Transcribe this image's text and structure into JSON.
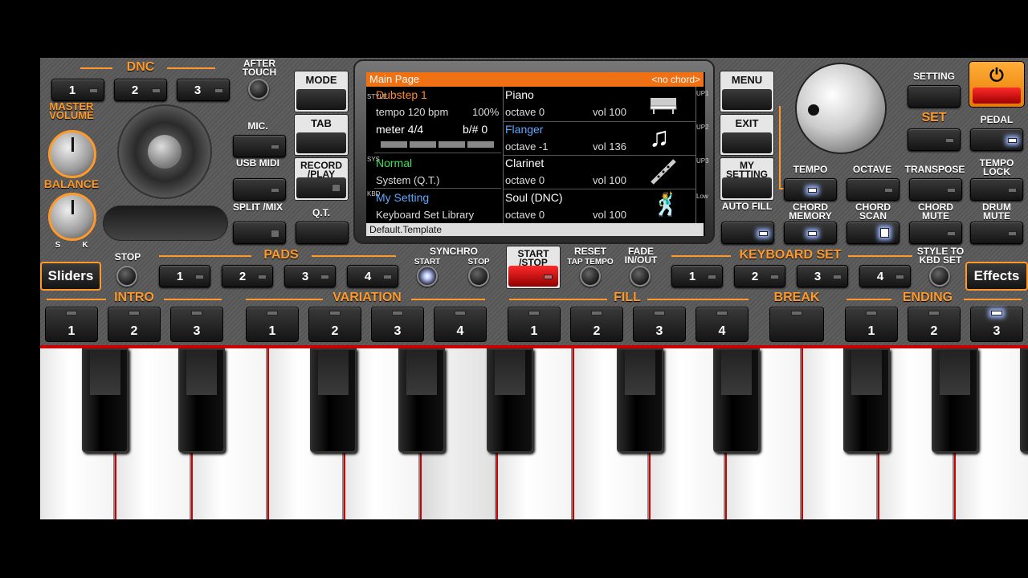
{
  "dnc": {
    "label": "DNC",
    "buttons": [
      "1",
      "2",
      "3"
    ]
  },
  "after_touch": "AFTER TOUCH",
  "master_volume": "MASTER VOLUME",
  "balance": {
    "label": "BALANCE",
    "s": "S",
    "k": "K"
  },
  "left_buttons": {
    "mic": "MIC.",
    "usb_midi": "USB MIDI",
    "split_mix": "SPLIT /MIX"
  },
  "sliders": "Sliders",
  "effects": "Effects",
  "mid_buttons": {
    "mode": "MODE",
    "tab": "TAB",
    "record_play": "RECORD /PLAY",
    "qt": "Q.T."
  },
  "screen": {
    "header_title": "Main Page",
    "header_chord": "<no chord>",
    "style_name": "Dubstep 1",
    "tempo": "tempo 120 bpm",
    "percent": "100%",
    "meter": "meter 4/4",
    "bsharp": "b/# 0",
    "sys_name": "Normal",
    "sys_sub": "System (Q.T.)",
    "kbd_name": "My Setting",
    "kbd_sub": "Keyboard Set Library",
    "up1_name": "Piano",
    "up1_oct": "octave  0",
    "up1_vol": "vol 100",
    "up2_name": "Flanger",
    "up2_oct": "octave -1",
    "up2_vol": "vol 136",
    "up3_name": "Clarinet",
    "up3_oct": "octave  0",
    "up3_vol": "vol 100",
    "low_name": "Soul (DNC)",
    "low_oct": "octave  0",
    "low_vol": "vol 100",
    "footer": "Default.Template",
    "side_style": "STYLE",
    "side_sys": "SYS",
    "side_kbd": "KBD",
    "side_up1": "UP1",
    "side_up2": "UP2",
    "side_up3": "UP3",
    "side_low": "Low"
  },
  "right_mid": {
    "menu": "MENU",
    "exit": "EXIT",
    "my_setting": "MY SETTING",
    "auto_fill": "AUTO FILL"
  },
  "right": {
    "setting": "SETTING",
    "set": "SET",
    "pedal": "PEDAL",
    "tempo": "TEMPO",
    "octave": "OCTAVE",
    "transpose": "TRANSPOSE",
    "tempo_lock": "TEMPO LOCK",
    "chord_memory": "CHORD MEMORY",
    "chord_scan": "CHORD SCAN",
    "chord_mute": "CHORD MUTE",
    "drum_mute": "DRUM MUTE"
  },
  "row": {
    "stop": "STOP",
    "pads": "PADS",
    "pad_buttons": [
      "1",
      "2",
      "3",
      "4"
    ],
    "synchro": "SYNCHRO",
    "synchro_start": "START",
    "synchro_stop": "STOP",
    "start_stop": "START /STOP",
    "reset": "RESET",
    "tap_tempo": "TAP TEMPO",
    "fade": "FADE IN/OUT",
    "keyboard_set": "KEYBOARD SET",
    "kbd_buttons": [
      "1",
      "2",
      "3",
      "4"
    ],
    "style_to_kbd": "STYLE TO KBD SET"
  },
  "sections": {
    "intro": "INTRO",
    "intro_buttons": [
      "1",
      "2",
      "3"
    ],
    "variation": "VARIATION",
    "variation_buttons": [
      "1",
      "2",
      "3",
      "4"
    ],
    "fill": "FILL",
    "fill_buttons": [
      "1",
      "2",
      "3",
      "4"
    ],
    "break": "BREAK",
    "ending": "ENDING",
    "ending_buttons": [
      "1",
      "2",
      "3"
    ]
  },
  "colors": {
    "accent": "#ff9a2a",
    "display_header": "#f07014",
    "power": "#e60000",
    "led_on": "#9bb7ff"
  }
}
